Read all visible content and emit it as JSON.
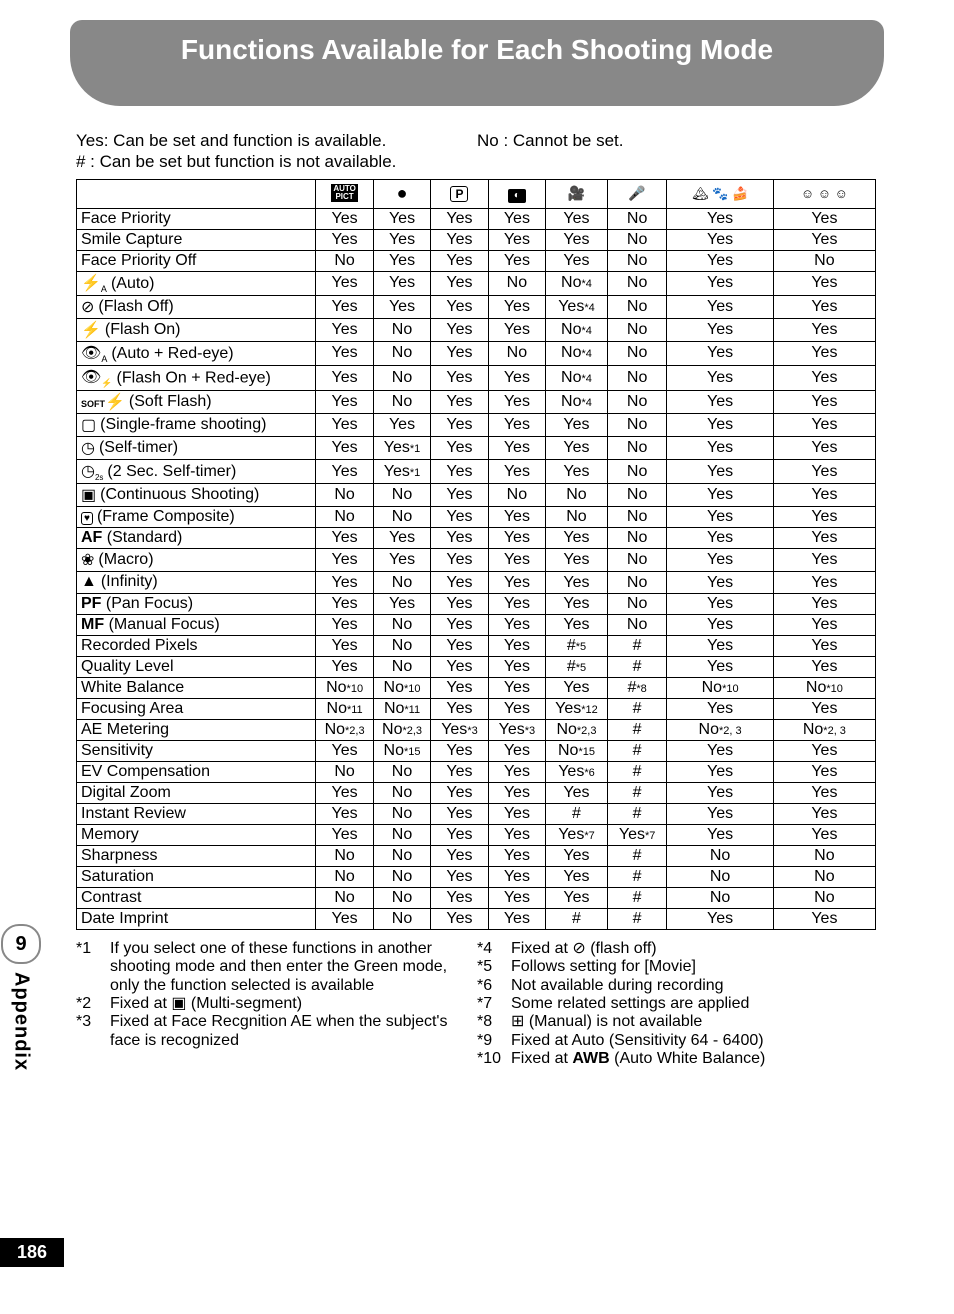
{
  "header": {
    "title": "Functions Available for Each Shooting Mode"
  },
  "legend": {
    "yes": "Yes: Can be set and function is available.",
    "no": "No : Cannot be set.",
    "hash": "#   : Can be set but function is not available."
  },
  "columns": [
    {
      "id": "auto-pict",
      "label": "AUTO PICT"
    },
    {
      "id": "green",
      "label": "●"
    },
    {
      "id": "program",
      "label": "P"
    },
    {
      "id": "night",
      "label": "🌃"
    },
    {
      "id": "movie",
      "label": "🎬"
    },
    {
      "id": "voice",
      "label": "🎤"
    },
    {
      "id": "scene-group",
      "label": "⛰ 🐾 🍰"
    },
    {
      "id": "face-group",
      "label": "😊 😊 😊"
    }
  ],
  "rows": [
    {
      "fn": "Face Priority",
      "v": [
        "Yes",
        "Yes",
        "Yes",
        "Yes",
        "Yes",
        "No",
        "Yes",
        "Yes"
      ]
    },
    {
      "fn": "Smile Capture",
      "v": [
        "Yes",
        "Yes",
        "Yes",
        "Yes",
        "Yes",
        "No",
        "Yes",
        "Yes"
      ]
    },
    {
      "fn": "Face Priority Off",
      "v": [
        "No",
        "Yes",
        "Yes",
        "Yes",
        "Yes",
        "No",
        "Yes",
        "No"
      ]
    },
    {
      "icon": "flash-auto",
      "fn": "(Auto)",
      "v": [
        "Yes",
        "Yes",
        "Yes",
        "No",
        "No*4",
        "No",
        "Yes",
        "Yes"
      ]
    },
    {
      "icon": "flash-off",
      "fn": "(Flash Off)",
      "v": [
        "Yes",
        "Yes",
        "Yes",
        "Yes",
        "Yes*4",
        "No",
        "Yes",
        "Yes"
      ]
    },
    {
      "icon": "flash-on",
      "fn": "(Flash On)",
      "v": [
        "Yes",
        "No",
        "Yes",
        "Yes",
        "No*4",
        "No",
        "Yes",
        "Yes"
      ]
    },
    {
      "icon": "flash-auto-redeye",
      "fn": "(Auto + Red-eye)",
      "v": [
        "Yes",
        "No",
        "Yes",
        "No",
        "No*4",
        "No",
        "Yes",
        "Yes"
      ]
    },
    {
      "icon": "flash-on-redeye",
      "fn": "(Flash On + Red-eye)",
      "v": [
        "Yes",
        "No",
        "Yes",
        "Yes",
        "No*4",
        "No",
        "Yes",
        "Yes"
      ]
    },
    {
      "icon": "soft-flash",
      "fn": "(Soft Flash)",
      "v": [
        "Yes",
        "No",
        "Yes",
        "Yes",
        "No*4",
        "No",
        "Yes",
        "Yes"
      ]
    },
    {
      "icon": "single-frame",
      "fn": "(Single-frame shooting)",
      "v": [
        "Yes",
        "Yes",
        "Yes",
        "Yes",
        "Yes",
        "No",
        "Yes",
        "Yes"
      ]
    },
    {
      "icon": "self-timer",
      "fn": "(Self-timer)",
      "v": [
        "Yes",
        "Yes*1",
        "Yes",
        "Yes",
        "Yes",
        "No",
        "Yes",
        "Yes"
      ]
    },
    {
      "icon": "self-timer-2s",
      "fn": "(2 Sec. Self-timer)",
      "v": [
        "Yes",
        "Yes*1",
        "Yes",
        "Yes",
        "Yes",
        "No",
        "Yes",
        "Yes"
      ]
    },
    {
      "icon": "continuous",
      "fn": "(Continuous Shooting)",
      "v": [
        "No",
        "No",
        "Yes",
        "No",
        "No",
        "No",
        "Yes",
        "Yes"
      ]
    },
    {
      "icon": "frame-composite",
      "fn": "(Frame Composite)",
      "v": [
        "No",
        "No",
        "Yes",
        "Yes",
        "No",
        "No",
        "Yes",
        "Yes"
      ]
    },
    {
      "prefix": "AF",
      "fn": "(Standard)",
      "v": [
        "Yes",
        "Yes",
        "Yes",
        "Yes",
        "Yes",
        "No",
        "Yes",
        "Yes"
      ]
    },
    {
      "icon": "macro",
      "fn": "(Macro)",
      "v": [
        "Yes",
        "Yes",
        "Yes",
        "Yes",
        "Yes",
        "No",
        "Yes",
        "Yes"
      ]
    },
    {
      "icon": "infinity",
      "fn": "(Infinity)",
      "v": [
        "Yes",
        "No",
        "Yes",
        "Yes",
        "Yes",
        "No",
        "Yes",
        "Yes"
      ]
    },
    {
      "prefix": "PF",
      "fn": "(Pan Focus)",
      "v": [
        "Yes",
        "Yes",
        "Yes",
        "Yes",
        "Yes",
        "No",
        "Yes",
        "Yes"
      ]
    },
    {
      "prefix": "MF",
      "fn": "(Manual Focus)",
      "v": [
        "Yes",
        "No",
        "Yes",
        "Yes",
        "Yes",
        "No",
        "Yes",
        "Yes"
      ]
    },
    {
      "fn": "Recorded Pixels",
      "v": [
        "Yes",
        "No",
        "Yes",
        "Yes",
        "#*5",
        "#",
        "Yes",
        "Yes"
      ]
    },
    {
      "fn": "Quality Level",
      "v": [
        "Yes",
        "No",
        "Yes",
        "Yes",
        "#*5",
        "#",
        "Yes",
        "Yes"
      ]
    },
    {
      "fn": "White Balance",
      "v": [
        "No*10",
        "No*10",
        "Yes",
        "Yes",
        "Yes",
        "#*8",
        "No*10",
        "No*10"
      ]
    },
    {
      "fn": "Focusing Area",
      "v": [
        "No*11",
        "No*11",
        "Yes",
        "Yes",
        "Yes*12",
        "#",
        "Yes",
        "Yes"
      ]
    },
    {
      "fn": "AE Metering",
      "v": [
        "No*2,3",
        "No*2,3",
        "Yes*3",
        "Yes*3",
        "No*2,3",
        "#",
        "No*2, 3",
        "No*2, 3"
      ]
    },
    {
      "fn": "Sensitivity",
      "v": [
        "Yes",
        "No*15",
        "Yes",
        "Yes",
        "No*15",
        "#",
        "Yes",
        "Yes"
      ]
    },
    {
      "fn": "EV Compensation",
      "v": [
        "No",
        "No",
        "Yes",
        "Yes",
        "Yes*6",
        "#",
        "Yes",
        "Yes"
      ]
    },
    {
      "fn": "Digital Zoom",
      "v": [
        "Yes",
        "No",
        "Yes",
        "Yes",
        "Yes",
        "#",
        "Yes",
        "Yes"
      ]
    },
    {
      "fn": "Instant Review",
      "v": [
        "Yes",
        "No",
        "Yes",
        "Yes",
        "#",
        "#",
        "Yes",
        "Yes"
      ]
    },
    {
      "fn": "Memory",
      "v": [
        "Yes",
        "No",
        "Yes",
        "Yes",
        "Yes*7",
        "Yes*7",
        "Yes",
        "Yes"
      ]
    },
    {
      "fn": "Sharpness",
      "v": [
        "No",
        "No",
        "Yes",
        "Yes",
        "Yes",
        "#",
        "No",
        "No"
      ]
    },
    {
      "fn": "Saturation",
      "v": [
        "No",
        "No",
        "Yes",
        "Yes",
        "Yes",
        "#",
        "No",
        "No"
      ]
    },
    {
      "fn": "Contrast",
      "v": [
        "No",
        "No",
        "Yes",
        "Yes",
        "Yes",
        "#",
        "No",
        "No"
      ]
    },
    {
      "fn": "Date Imprint",
      "v": [
        "Yes",
        "No",
        "Yes",
        "Yes",
        "#",
        "#",
        "Yes",
        "Yes"
      ]
    }
  ],
  "footnotes_left": [
    {
      "id": "*1",
      "text": "If you select one of these functions in another shooting mode and then enter the Green mode, only the function selected is available"
    },
    {
      "id": "*2",
      "text": "Fixed at ▣ (Multi-segment)"
    },
    {
      "id": "*3",
      "text": "Fixed at Face Recgnition AE when the subject's face is recognized"
    }
  ],
  "footnotes_right": [
    {
      "id": "*4",
      "text": "Fixed at ⊘ (flash off)"
    },
    {
      "id": "*5",
      "text": "Follows setting for [Movie]"
    },
    {
      "id": "*6",
      "text": "Not available during recording"
    },
    {
      "id": "*7",
      "text": "Some related settings are applied"
    },
    {
      "id": "*8",
      "text": "⊞ (Manual) is not available"
    },
    {
      "id": "*9",
      "text": "Fixed at Auto (Sensitivity 64 - 6400)"
    },
    {
      "id": "*10",
      "text": "Fixed at AWB (Auto White Balance)"
    }
  ],
  "side": {
    "chapter": "9",
    "label": "Appendix"
  },
  "page_number": "186"
}
